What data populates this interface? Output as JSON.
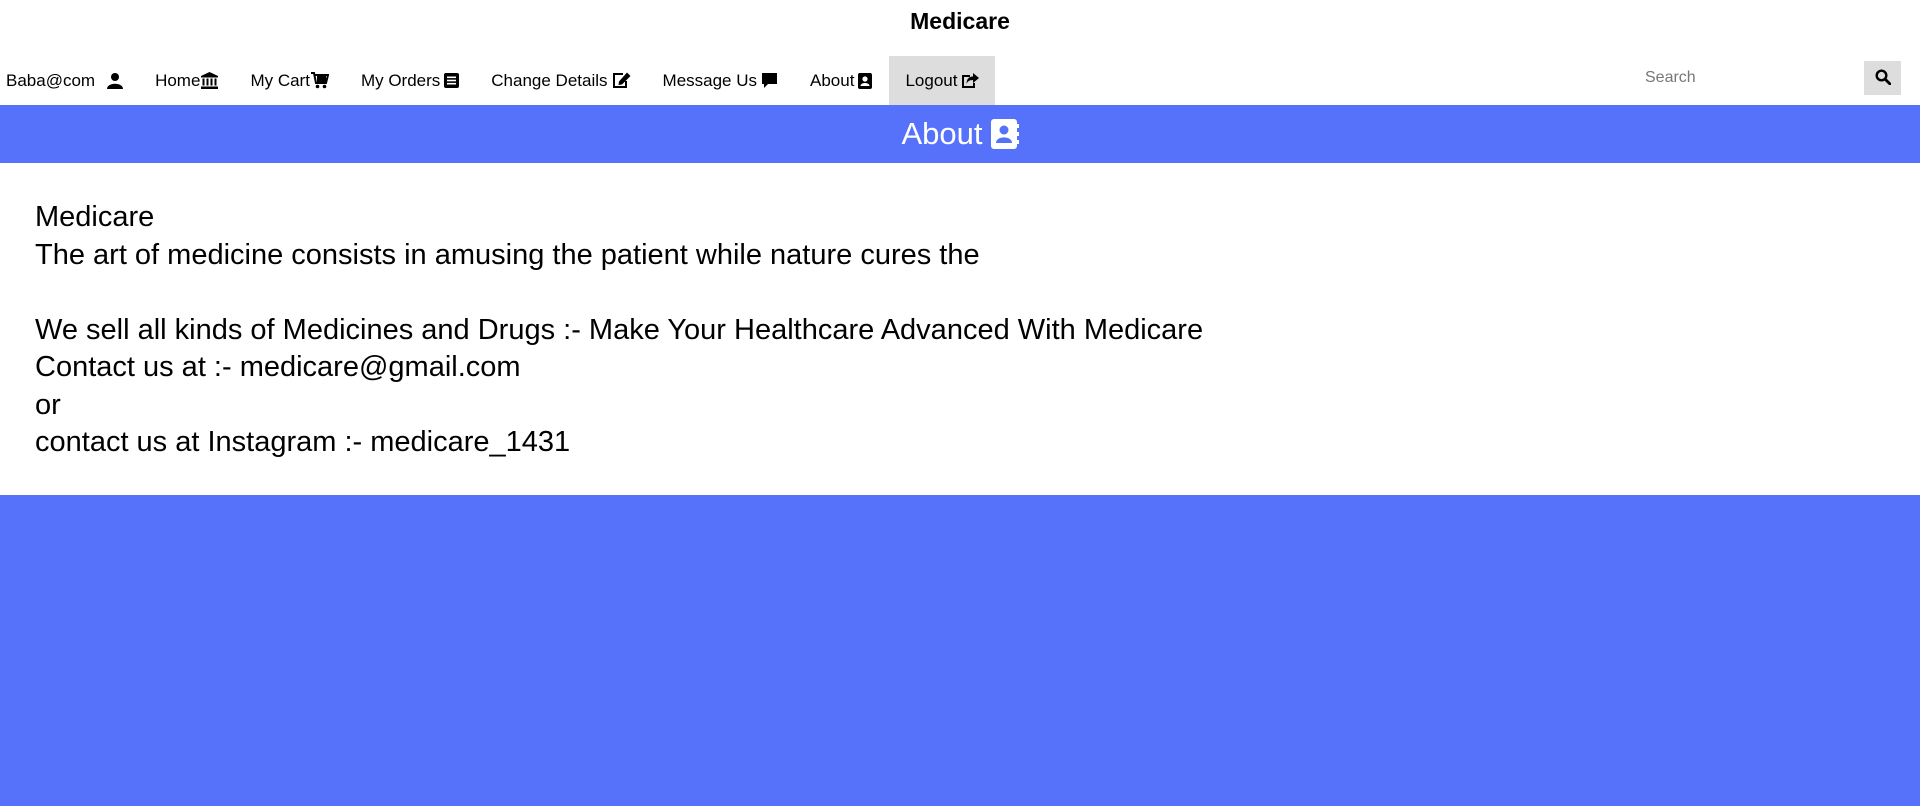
{
  "app": {
    "title": "Medicare"
  },
  "nav": {
    "user": "Baba@com",
    "items": [
      {
        "label": "Home",
        "icon": "bank-icon"
      },
      {
        "label": "My Cart",
        "icon": "cart-icon"
      },
      {
        "label": "My Orders",
        "icon": "list-alt-icon"
      },
      {
        "label": "Change Details",
        "icon": "edit-icon"
      },
      {
        "label": "Message Us",
        "icon": "comment-icon"
      },
      {
        "label": "About",
        "icon": "contact-card-icon"
      },
      {
        "label": "Logout",
        "icon": "share-out-icon",
        "active": true
      }
    ]
  },
  "search": {
    "placeholder": "Search",
    "value": ""
  },
  "about_header": {
    "label": "About"
  },
  "content": {
    "lines": [
      "Medicare",
      "The art of medicine consists in amusing the patient while nature cures the",
      "",
      "We sell all kinds of Medicines and Drugs :- Make Your Healthcare Advanced With Medicare",
      "Contact us at :- medicare@gmail.com",
      "or",
      "contact us at Instagram :- medicare_1431"
    ]
  },
  "colors": {
    "accent": "#5672fa",
    "active_nav": "#dddddd"
  }
}
